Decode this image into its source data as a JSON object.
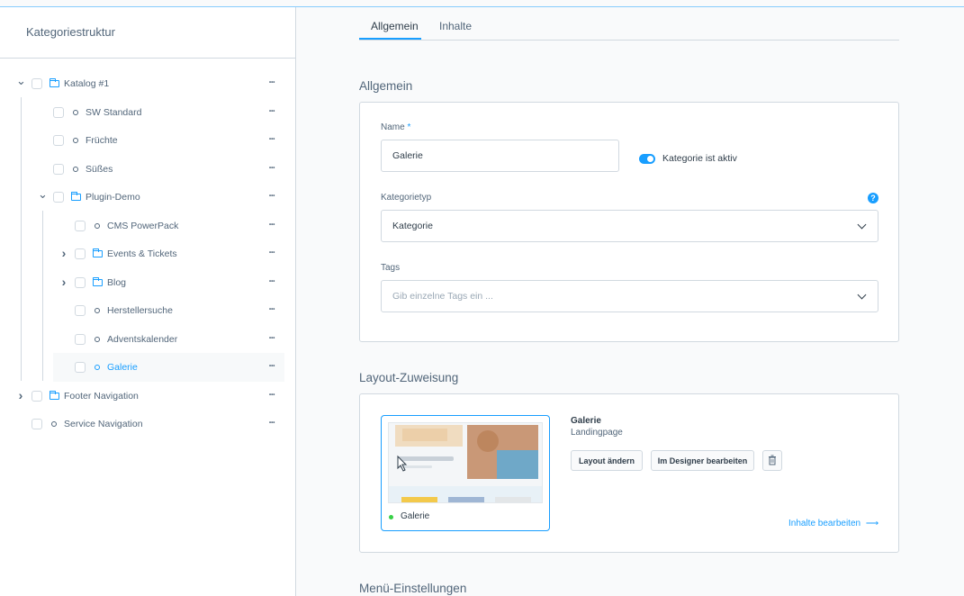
{
  "sidebar": {
    "title": "Kategoriestruktur",
    "tree": [
      {
        "label": "Katalog #1",
        "type": "folder",
        "level": 0,
        "expanded": true
      },
      {
        "label": "SW Standard",
        "type": "item",
        "level": 1
      },
      {
        "label": "Früchte",
        "type": "item",
        "level": 1
      },
      {
        "label": "Süßes",
        "type": "item",
        "level": 1
      },
      {
        "label": "Plugin-Demo",
        "type": "folder",
        "level": 1,
        "expanded": true
      },
      {
        "label": "CMS PowerPack",
        "type": "item",
        "level": 2
      },
      {
        "label": "Events & Tickets",
        "type": "folder",
        "level": 2,
        "expanded": false
      },
      {
        "label": "Blog",
        "type": "folder",
        "level": 2,
        "expanded": false
      },
      {
        "label": "Herstellersuche",
        "type": "item",
        "level": 2
      },
      {
        "label": "Adventskalender",
        "type": "item",
        "level": 2
      },
      {
        "label": "Galerie",
        "type": "item",
        "level": 2,
        "active": true
      },
      {
        "label": "Footer Navigation",
        "type": "folder",
        "level": 0,
        "expanded": false
      },
      {
        "label": "Service Navigation",
        "type": "item",
        "level": 0
      }
    ]
  },
  "tabs": [
    {
      "label": "Allgemein",
      "active": true
    },
    {
      "label": "Inhalte",
      "active": false
    }
  ],
  "general": {
    "title": "Allgemein",
    "name_label": "Name",
    "name_required": "*",
    "name_value": "Galerie",
    "active_label": "Kategorie ist aktiv",
    "active": true,
    "type_label": "Kategorietyp",
    "type_value": "Kategorie",
    "help_icon": "?",
    "tags_label": "Tags",
    "tags_placeholder": "Gib einzelne Tags ein ..."
  },
  "layout": {
    "title": "Layout-Zuweisung",
    "preview_label": "Galerie",
    "name": "Galerie",
    "type": "Landingpage",
    "change_button": "Layout ändern",
    "designer_button": "Im Designer bearbeiten",
    "edit_link": "Inhalte bearbeiten",
    "edit_arrow": "⟶"
  },
  "menu_settings": {
    "title": "Menü-Einstellungen"
  },
  "colors": {
    "accent": "#189eff",
    "success": "#37d046",
    "text": "#52667a",
    "border": "#d1d9e0"
  }
}
